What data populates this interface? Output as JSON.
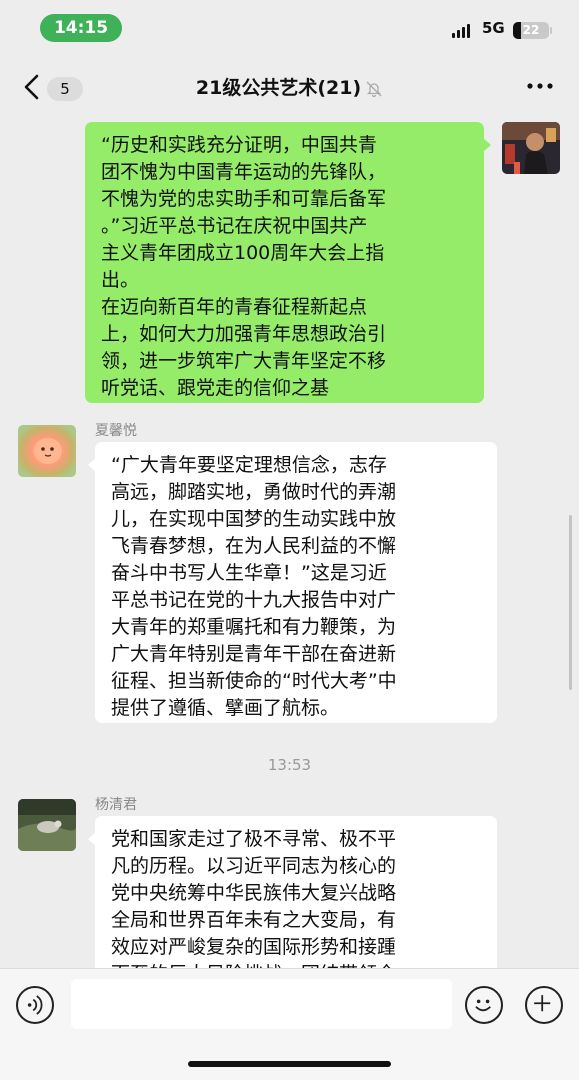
{
  "status_bar": {
    "time": "14:15",
    "network": "5G",
    "battery": "22",
    "battery_level": 0.22
  },
  "header": {
    "back_icon": "chevron-left-icon",
    "unread_count": "5",
    "title": "21级公共艺术(21)",
    "mute_icon": "bell-slash-icon",
    "more_icon": "more-dots-icon"
  },
  "messages": [
    {
      "type": "self",
      "text": "“历史和实践充分证明，中国共青\n团不愧为中国青年运动的先锋队，\n不愧为党的忠实助手和可靠后备军\n。”习近平总书记在庆祝中国共产\n主义青年团成立100周年大会上指\n出。\n在迈向新百年的青春征程新起点\n上，如何大力加强青年思想政治引\n领，进一步筑牢广大青年坚定不移\n听党话、跟党走的信仰之基"
    },
    {
      "type": "other",
      "sender": "夏馨悦",
      "text": "“广大青年要坚定理想信念，志存\n高远，脚踏实地，勇做时代的弄潮\n儿，在实现中国梦的生动实践中放\n飞青春梦想，在为人民利益的不懈\n奋斗中书写人生华章！”这是习近\n平总书记在党的十九大报告中对广\n大青年的郑重嘱托和有力鞭策，为\n广大青年特别是青年干部在奋进新\n征程、担当新使命的“时代大考”中\n提供了遵循、擘画了航标。"
    },
    {
      "type": "time",
      "text": "13:53"
    },
    {
      "type": "other",
      "sender": "杨清君",
      "text": "党和国家走过了极不寻常、极不平\n凡的历程。以习近平同志为核心的\n党中央统筹中华民族伟大复兴战略\n全局和世界百年未有之大变局，有\n效应对严峻复杂的国际形势和接踵\n而至的巨大风险挑战，团结带领全"
    }
  ],
  "input_bar": {
    "voice_icon": "voice-icon",
    "emoji_icon": "emoji-icon",
    "plus_icon": "plus-icon",
    "placeholder": ""
  }
}
